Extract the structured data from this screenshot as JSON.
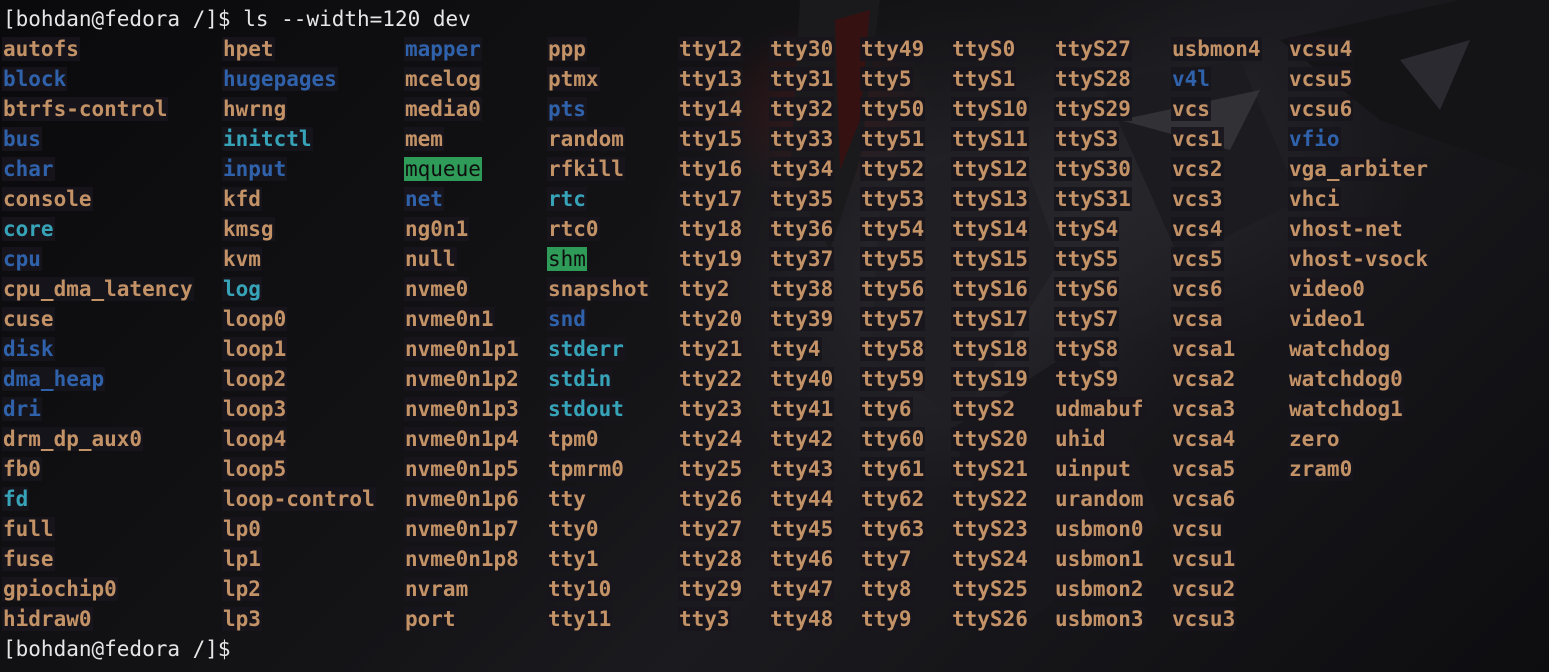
{
  "terminal": {
    "prompt": "[bohdan@fedora /]$",
    "command": "ls --width=120 dev",
    "colors": {
      "background": "#0c0c0e",
      "text": "#e6e6e6",
      "file": "#c39266",
      "directory": "#2f62ab",
      "symlink": "#37a3b8",
      "sticky_dir_bg": "#2e9c58"
    },
    "columns": [
      [
        {
          "name": "autofs",
          "type": "file"
        },
        {
          "name": "block",
          "type": "dir"
        },
        {
          "name": "btrfs-control",
          "type": "file"
        },
        {
          "name": "bus",
          "type": "dir"
        },
        {
          "name": "char",
          "type": "dir"
        },
        {
          "name": "console",
          "type": "file"
        },
        {
          "name": "core",
          "type": "link"
        },
        {
          "name": "cpu",
          "type": "dir"
        },
        {
          "name": "cpu_dma_latency",
          "type": "file"
        },
        {
          "name": "cuse",
          "type": "file"
        },
        {
          "name": "disk",
          "type": "dir"
        },
        {
          "name": "dma_heap",
          "type": "dir"
        },
        {
          "name": "dri",
          "type": "dir"
        },
        {
          "name": "drm_dp_aux0",
          "type": "file"
        },
        {
          "name": "fb0",
          "type": "file"
        },
        {
          "name": "fd",
          "type": "link"
        },
        {
          "name": "full",
          "type": "file"
        },
        {
          "name": "fuse",
          "type": "file"
        },
        {
          "name": "gpiochip0",
          "type": "file"
        },
        {
          "name": "hidraw0",
          "type": "file"
        }
      ],
      [
        {
          "name": "hpet",
          "type": "file"
        },
        {
          "name": "hugepages",
          "type": "dir"
        },
        {
          "name": "hwrng",
          "type": "file"
        },
        {
          "name": "initctl",
          "type": "link"
        },
        {
          "name": "input",
          "type": "dir"
        },
        {
          "name": "kfd",
          "type": "file"
        },
        {
          "name": "kmsg",
          "type": "file"
        },
        {
          "name": "kvm",
          "type": "file"
        },
        {
          "name": "log",
          "type": "link"
        },
        {
          "name": "loop0",
          "type": "file"
        },
        {
          "name": "loop1",
          "type": "file"
        },
        {
          "name": "loop2",
          "type": "file"
        },
        {
          "name": "loop3",
          "type": "file"
        },
        {
          "name": "loop4",
          "type": "file"
        },
        {
          "name": "loop5",
          "type": "file"
        },
        {
          "name": "loop-control",
          "type": "file"
        },
        {
          "name": "lp0",
          "type": "file"
        },
        {
          "name": "lp1",
          "type": "file"
        },
        {
          "name": "lp2",
          "type": "file"
        },
        {
          "name": "lp3",
          "type": "file"
        }
      ],
      [
        {
          "name": "mapper",
          "type": "dir"
        },
        {
          "name": "mcelog",
          "type": "file"
        },
        {
          "name": "media0",
          "type": "file"
        },
        {
          "name": "mem",
          "type": "file"
        },
        {
          "name": "mqueue",
          "type": "sticky"
        },
        {
          "name": "net",
          "type": "dir"
        },
        {
          "name": "ng0n1",
          "type": "file"
        },
        {
          "name": "null",
          "type": "file"
        },
        {
          "name": "nvme0",
          "type": "file"
        },
        {
          "name": "nvme0n1",
          "type": "file"
        },
        {
          "name": "nvme0n1p1",
          "type": "file"
        },
        {
          "name": "nvme0n1p2",
          "type": "file"
        },
        {
          "name": "nvme0n1p3",
          "type": "file"
        },
        {
          "name": "nvme0n1p4",
          "type": "file"
        },
        {
          "name": "nvme0n1p5",
          "type": "file"
        },
        {
          "name": "nvme0n1p6",
          "type": "file"
        },
        {
          "name": "nvme0n1p7",
          "type": "file"
        },
        {
          "name": "nvme0n1p8",
          "type": "file"
        },
        {
          "name": "nvram",
          "type": "file"
        },
        {
          "name": "port",
          "type": "file"
        }
      ],
      [
        {
          "name": "ppp",
          "type": "file"
        },
        {
          "name": "ptmx",
          "type": "file"
        },
        {
          "name": "pts",
          "type": "dir"
        },
        {
          "name": "random",
          "type": "file"
        },
        {
          "name": "rfkill",
          "type": "file"
        },
        {
          "name": "rtc",
          "type": "link"
        },
        {
          "name": "rtc0",
          "type": "file"
        },
        {
          "name": "shm",
          "type": "sticky"
        },
        {
          "name": "snapshot",
          "type": "file"
        },
        {
          "name": "snd",
          "type": "dir"
        },
        {
          "name": "stderr",
          "type": "link"
        },
        {
          "name": "stdin",
          "type": "link"
        },
        {
          "name": "stdout",
          "type": "link"
        },
        {
          "name": "tpm0",
          "type": "file"
        },
        {
          "name": "tpmrm0",
          "type": "file"
        },
        {
          "name": "tty",
          "type": "file"
        },
        {
          "name": "tty0",
          "type": "file"
        },
        {
          "name": "tty1",
          "type": "file"
        },
        {
          "name": "tty10",
          "type": "file"
        },
        {
          "name": "tty11",
          "type": "file"
        }
      ],
      [
        {
          "name": "tty12",
          "type": "file"
        },
        {
          "name": "tty13",
          "type": "file"
        },
        {
          "name": "tty14",
          "type": "file"
        },
        {
          "name": "tty15",
          "type": "file"
        },
        {
          "name": "tty16",
          "type": "file"
        },
        {
          "name": "tty17",
          "type": "file"
        },
        {
          "name": "tty18",
          "type": "file"
        },
        {
          "name": "tty19",
          "type": "file"
        },
        {
          "name": "tty2",
          "type": "file"
        },
        {
          "name": "tty20",
          "type": "file"
        },
        {
          "name": "tty21",
          "type": "file"
        },
        {
          "name": "tty22",
          "type": "file"
        },
        {
          "name": "tty23",
          "type": "file"
        },
        {
          "name": "tty24",
          "type": "file"
        },
        {
          "name": "tty25",
          "type": "file"
        },
        {
          "name": "tty26",
          "type": "file"
        },
        {
          "name": "tty27",
          "type": "file"
        },
        {
          "name": "tty28",
          "type": "file"
        },
        {
          "name": "tty29",
          "type": "file"
        },
        {
          "name": "tty3",
          "type": "file"
        }
      ],
      [
        {
          "name": "tty30",
          "type": "file"
        },
        {
          "name": "tty31",
          "type": "file"
        },
        {
          "name": "tty32",
          "type": "file"
        },
        {
          "name": "tty33",
          "type": "file"
        },
        {
          "name": "tty34",
          "type": "file"
        },
        {
          "name": "tty35",
          "type": "file"
        },
        {
          "name": "tty36",
          "type": "file"
        },
        {
          "name": "tty37",
          "type": "file"
        },
        {
          "name": "tty38",
          "type": "file"
        },
        {
          "name": "tty39",
          "type": "file"
        },
        {
          "name": "tty4",
          "type": "file"
        },
        {
          "name": "tty40",
          "type": "file"
        },
        {
          "name": "tty41",
          "type": "file"
        },
        {
          "name": "tty42",
          "type": "file"
        },
        {
          "name": "tty43",
          "type": "file"
        },
        {
          "name": "tty44",
          "type": "file"
        },
        {
          "name": "tty45",
          "type": "file"
        },
        {
          "name": "tty46",
          "type": "file"
        },
        {
          "name": "tty47",
          "type": "file"
        },
        {
          "name": "tty48",
          "type": "file"
        }
      ],
      [
        {
          "name": "tty49",
          "type": "file"
        },
        {
          "name": "tty5",
          "type": "file"
        },
        {
          "name": "tty50",
          "type": "file"
        },
        {
          "name": "tty51",
          "type": "file"
        },
        {
          "name": "tty52",
          "type": "file"
        },
        {
          "name": "tty53",
          "type": "file"
        },
        {
          "name": "tty54",
          "type": "file"
        },
        {
          "name": "tty55",
          "type": "file"
        },
        {
          "name": "tty56",
          "type": "file"
        },
        {
          "name": "tty57",
          "type": "file"
        },
        {
          "name": "tty58",
          "type": "file"
        },
        {
          "name": "tty59",
          "type": "file"
        },
        {
          "name": "tty6",
          "type": "file"
        },
        {
          "name": "tty60",
          "type": "file"
        },
        {
          "name": "tty61",
          "type": "file"
        },
        {
          "name": "tty62",
          "type": "file"
        },
        {
          "name": "tty63",
          "type": "file"
        },
        {
          "name": "tty7",
          "type": "file"
        },
        {
          "name": "tty8",
          "type": "file"
        },
        {
          "name": "tty9",
          "type": "file"
        }
      ],
      [
        {
          "name": "ttyS0",
          "type": "file"
        },
        {
          "name": "ttyS1",
          "type": "file"
        },
        {
          "name": "ttyS10",
          "type": "file"
        },
        {
          "name": "ttyS11",
          "type": "file"
        },
        {
          "name": "ttyS12",
          "type": "file"
        },
        {
          "name": "ttyS13",
          "type": "file"
        },
        {
          "name": "ttyS14",
          "type": "file"
        },
        {
          "name": "ttyS15",
          "type": "file"
        },
        {
          "name": "ttyS16",
          "type": "file"
        },
        {
          "name": "ttyS17",
          "type": "file"
        },
        {
          "name": "ttyS18",
          "type": "file"
        },
        {
          "name": "ttyS19",
          "type": "file"
        },
        {
          "name": "ttyS2",
          "type": "file"
        },
        {
          "name": "ttyS20",
          "type": "file"
        },
        {
          "name": "ttyS21",
          "type": "file"
        },
        {
          "name": "ttyS22",
          "type": "file"
        },
        {
          "name": "ttyS23",
          "type": "file"
        },
        {
          "name": "ttyS24",
          "type": "file"
        },
        {
          "name": "ttyS25",
          "type": "file"
        },
        {
          "name": "ttyS26",
          "type": "file"
        }
      ],
      [
        {
          "name": "ttyS27",
          "type": "file"
        },
        {
          "name": "ttyS28",
          "type": "file"
        },
        {
          "name": "ttyS29",
          "type": "file"
        },
        {
          "name": "ttyS3",
          "type": "file"
        },
        {
          "name": "ttyS30",
          "type": "file"
        },
        {
          "name": "ttyS31",
          "type": "file"
        },
        {
          "name": "ttyS4",
          "type": "file"
        },
        {
          "name": "ttyS5",
          "type": "file"
        },
        {
          "name": "ttyS6",
          "type": "file"
        },
        {
          "name": "ttyS7",
          "type": "file"
        },
        {
          "name": "ttyS8",
          "type": "file"
        },
        {
          "name": "ttyS9",
          "type": "file"
        },
        {
          "name": "udmabuf",
          "type": "file"
        },
        {
          "name": "uhid",
          "type": "file"
        },
        {
          "name": "uinput",
          "type": "file"
        },
        {
          "name": "urandom",
          "type": "file"
        },
        {
          "name": "usbmon0",
          "type": "file"
        },
        {
          "name": "usbmon1",
          "type": "file"
        },
        {
          "name": "usbmon2",
          "type": "file"
        },
        {
          "name": "usbmon3",
          "type": "file"
        }
      ],
      [
        {
          "name": "usbmon4",
          "type": "file"
        },
        {
          "name": "v4l",
          "type": "dir"
        },
        {
          "name": "vcs",
          "type": "file"
        },
        {
          "name": "vcs1",
          "type": "file"
        },
        {
          "name": "vcs2",
          "type": "file"
        },
        {
          "name": "vcs3",
          "type": "file"
        },
        {
          "name": "vcs4",
          "type": "file"
        },
        {
          "name": "vcs5",
          "type": "file"
        },
        {
          "name": "vcs6",
          "type": "file"
        },
        {
          "name": "vcsa",
          "type": "file"
        },
        {
          "name": "vcsa1",
          "type": "file"
        },
        {
          "name": "vcsa2",
          "type": "file"
        },
        {
          "name": "vcsa3",
          "type": "file"
        },
        {
          "name": "vcsa4",
          "type": "file"
        },
        {
          "name": "vcsa5",
          "type": "file"
        },
        {
          "name": "vcsa6",
          "type": "file"
        },
        {
          "name": "vcsu",
          "type": "file"
        },
        {
          "name": "vcsu1",
          "type": "file"
        },
        {
          "name": "vcsu2",
          "type": "file"
        },
        {
          "name": "vcsu3",
          "type": "file"
        }
      ],
      [
        {
          "name": "vcsu4",
          "type": "file"
        },
        {
          "name": "vcsu5",
          "type": "file"
        },
        {
          "name": "vcsu6",
          "type": "file"
        },
        {
          "name": "vfio",
          "type": "dir"
        },
        {
          "name": "vga_arbiter",
          "type": "file"
        },
        {
          "name": "vhci",
          "type": "file"
        },
        {
          "name": "vhost-net",
          "type": "file"
        },
        {
          "name": "vhost-vsock",
          "type": "file"
        },
        {
          "name": "video0",
          "type": "file"
        },
        {
          "name": "video1",
          "type": "file"
        },
        {
          "name": "watchdog",
          "type": "file"
        },
        {
          "name": "watchdog0",
          "type": "file"
        },
        {
          "name": "watchdog1",
          "type": "file"
        },
        {
          "name": "zero",
          "type": "file"
        },
        {
          "name": "zram0",
          "type": "file"
        }
      ]
    ]
  }
}
